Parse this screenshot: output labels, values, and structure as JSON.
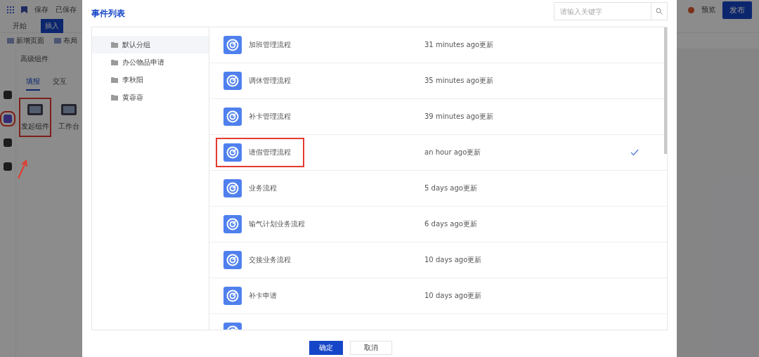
{
  "app": {
    "toolbar": {
      "save": "保存",
      "saved": "已保存",
      "preview": "预览",
      "publish": "发布"
    },
    "tabs": [
      {
        "label": "开始",
        "selected": false
      },
      {
        "label": "插入",
        "selected": true
      }
    ],
    "actions": [
      "新增页面",
      "布局"
    ],
    "rail": [
      {
        "selected": false
      },
      {
        "selected": true
      },
      {
        "selected": false
      },
      {
        "selected": false
      }
    ],
    "panel": {
      "title": "高级组件",
      "subtabs": [
        {
          "label": "填报",
          "selected": true
        },
        {
          "label": "交互",
          "selected": false
        }
      ],
      "components": [
        {
          "label": "发起组件",
          "highlighted": true
        },
        {
          "label": "工作台",
          "highlighted": false
        }
      ]
    }
  },
  "dialog": {
    "title": "事件列表",
    "search": {
      "placeholder": "请输入关键字"
    },
    "groups": [
      {
        "label": "默认分组",
        "selected": true
      },
      {
        "label": "办公物品申请",
        "selected": false
      },
      {
        "label": "李秋阳",
        "selected": false
      },
      {
        "label": "黄蓉蓉",
        "selected": false
      }
    ],
    "items": [
      {
        "kind": "row",
        "name": "加班管理流程",
        "updated": "31 minutes ago更新",
        "selected": false
      },
      {
        "kind": "row",
        "name": "调休管理流程",
        "updated": "35 minutes ago更新",
        "selected": false
      },
      {
        "kind": "row",
        "name": "补卡管理流程",
        "updated": "39 minutes ago更新",
        "selected": false
      },
      {
        "kind": "row",
        "name": "请假管理流程",
        "updated": "an hour ago更新",
        "selected": true
      },
      {
        "kind": "row",
        "name": "业务流程",
        "updated": "5 days ago更新",
        "selected": false
      },
      {
        "kind": "row",
        "name": "输气计划业务流程",
        "updated": "6 days ago更新",
        "selected": false
      },
      {
        "kind": "row",
        "name": "交接业务流程",
        "updated": "10 days ago更新",
        "selected": false
      },
      {
        "kind": "row",
        "name": "补卡申请",
        "updated": "10 days ago更新",
        "selected": false
      },
      {
        "kind": "cut"
      }
    ],
    "buttons": [
      {
        "kind": "primary",
        "label": "确定"
      },
      {
        "kind": "default",
        "label": "取消"
      }
    ]
  }
}
